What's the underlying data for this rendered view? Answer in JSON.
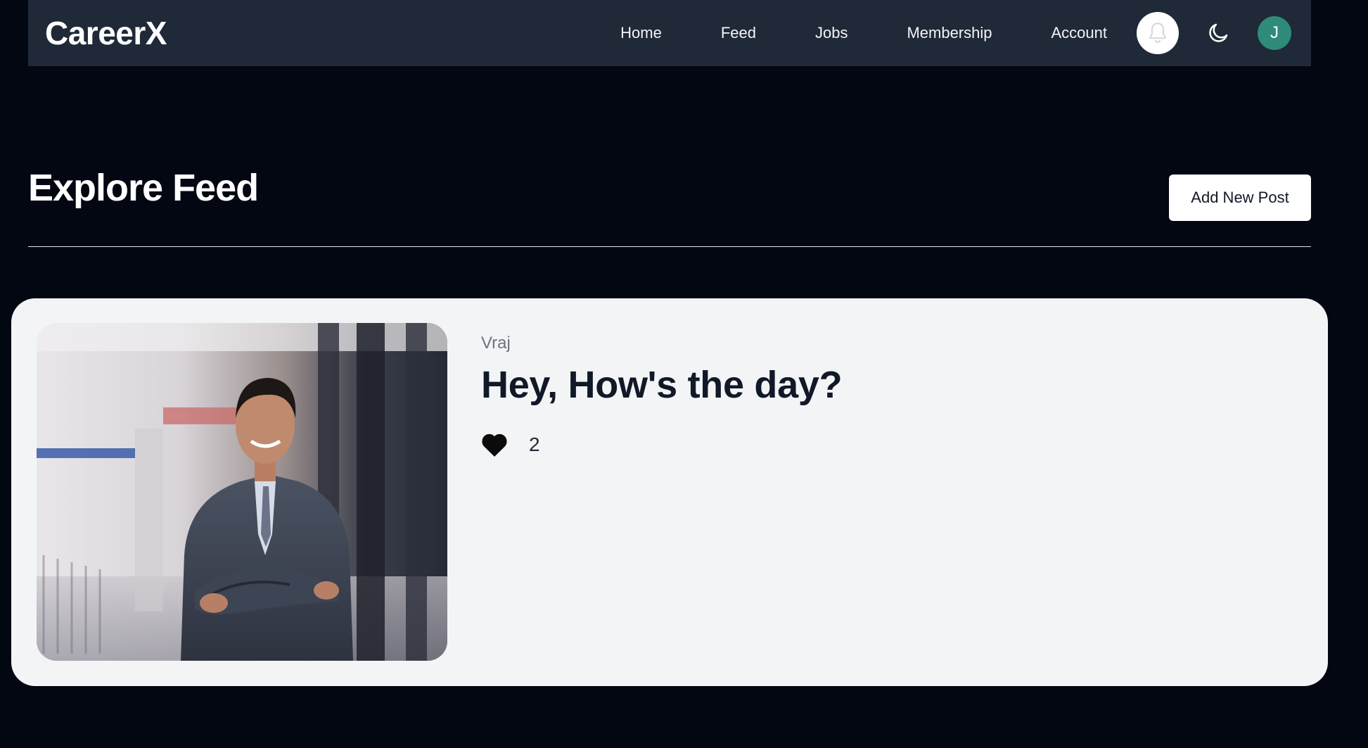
{
  "brand": "CareerX",
  "nav": {
    "items": [
      {
        "label": "Home"
      },
      {
        "label": "Feed"
      },
      {
        "label": "Jobs"
      },
      {
        "label": "Membership"
      },
      {
        "label": "Account"
      }
    ],
    "icons": {
      "notifications": "bell-icon",
      "theme_toggle": "moon-icon"
    },
    "avatar_initial": "J",
    "avatar_color": "#2e8b7a"
  },
  "page": {
    "title": "Explore Feed",
    "add_post_label": "Add New Post"
  },
  "posts": [
    {
      "author": "Vraj",
      "title": "Hey, How's the day?",
      "likes": "2",
      "image": "photo of a smiling man in a suit with arms crossed in a hallway"
    }
  ],
  "colors": {
    "background": "#030712",
    "navbar": "#1f2937",
    "card": "#f3f4f6"
  }
}
